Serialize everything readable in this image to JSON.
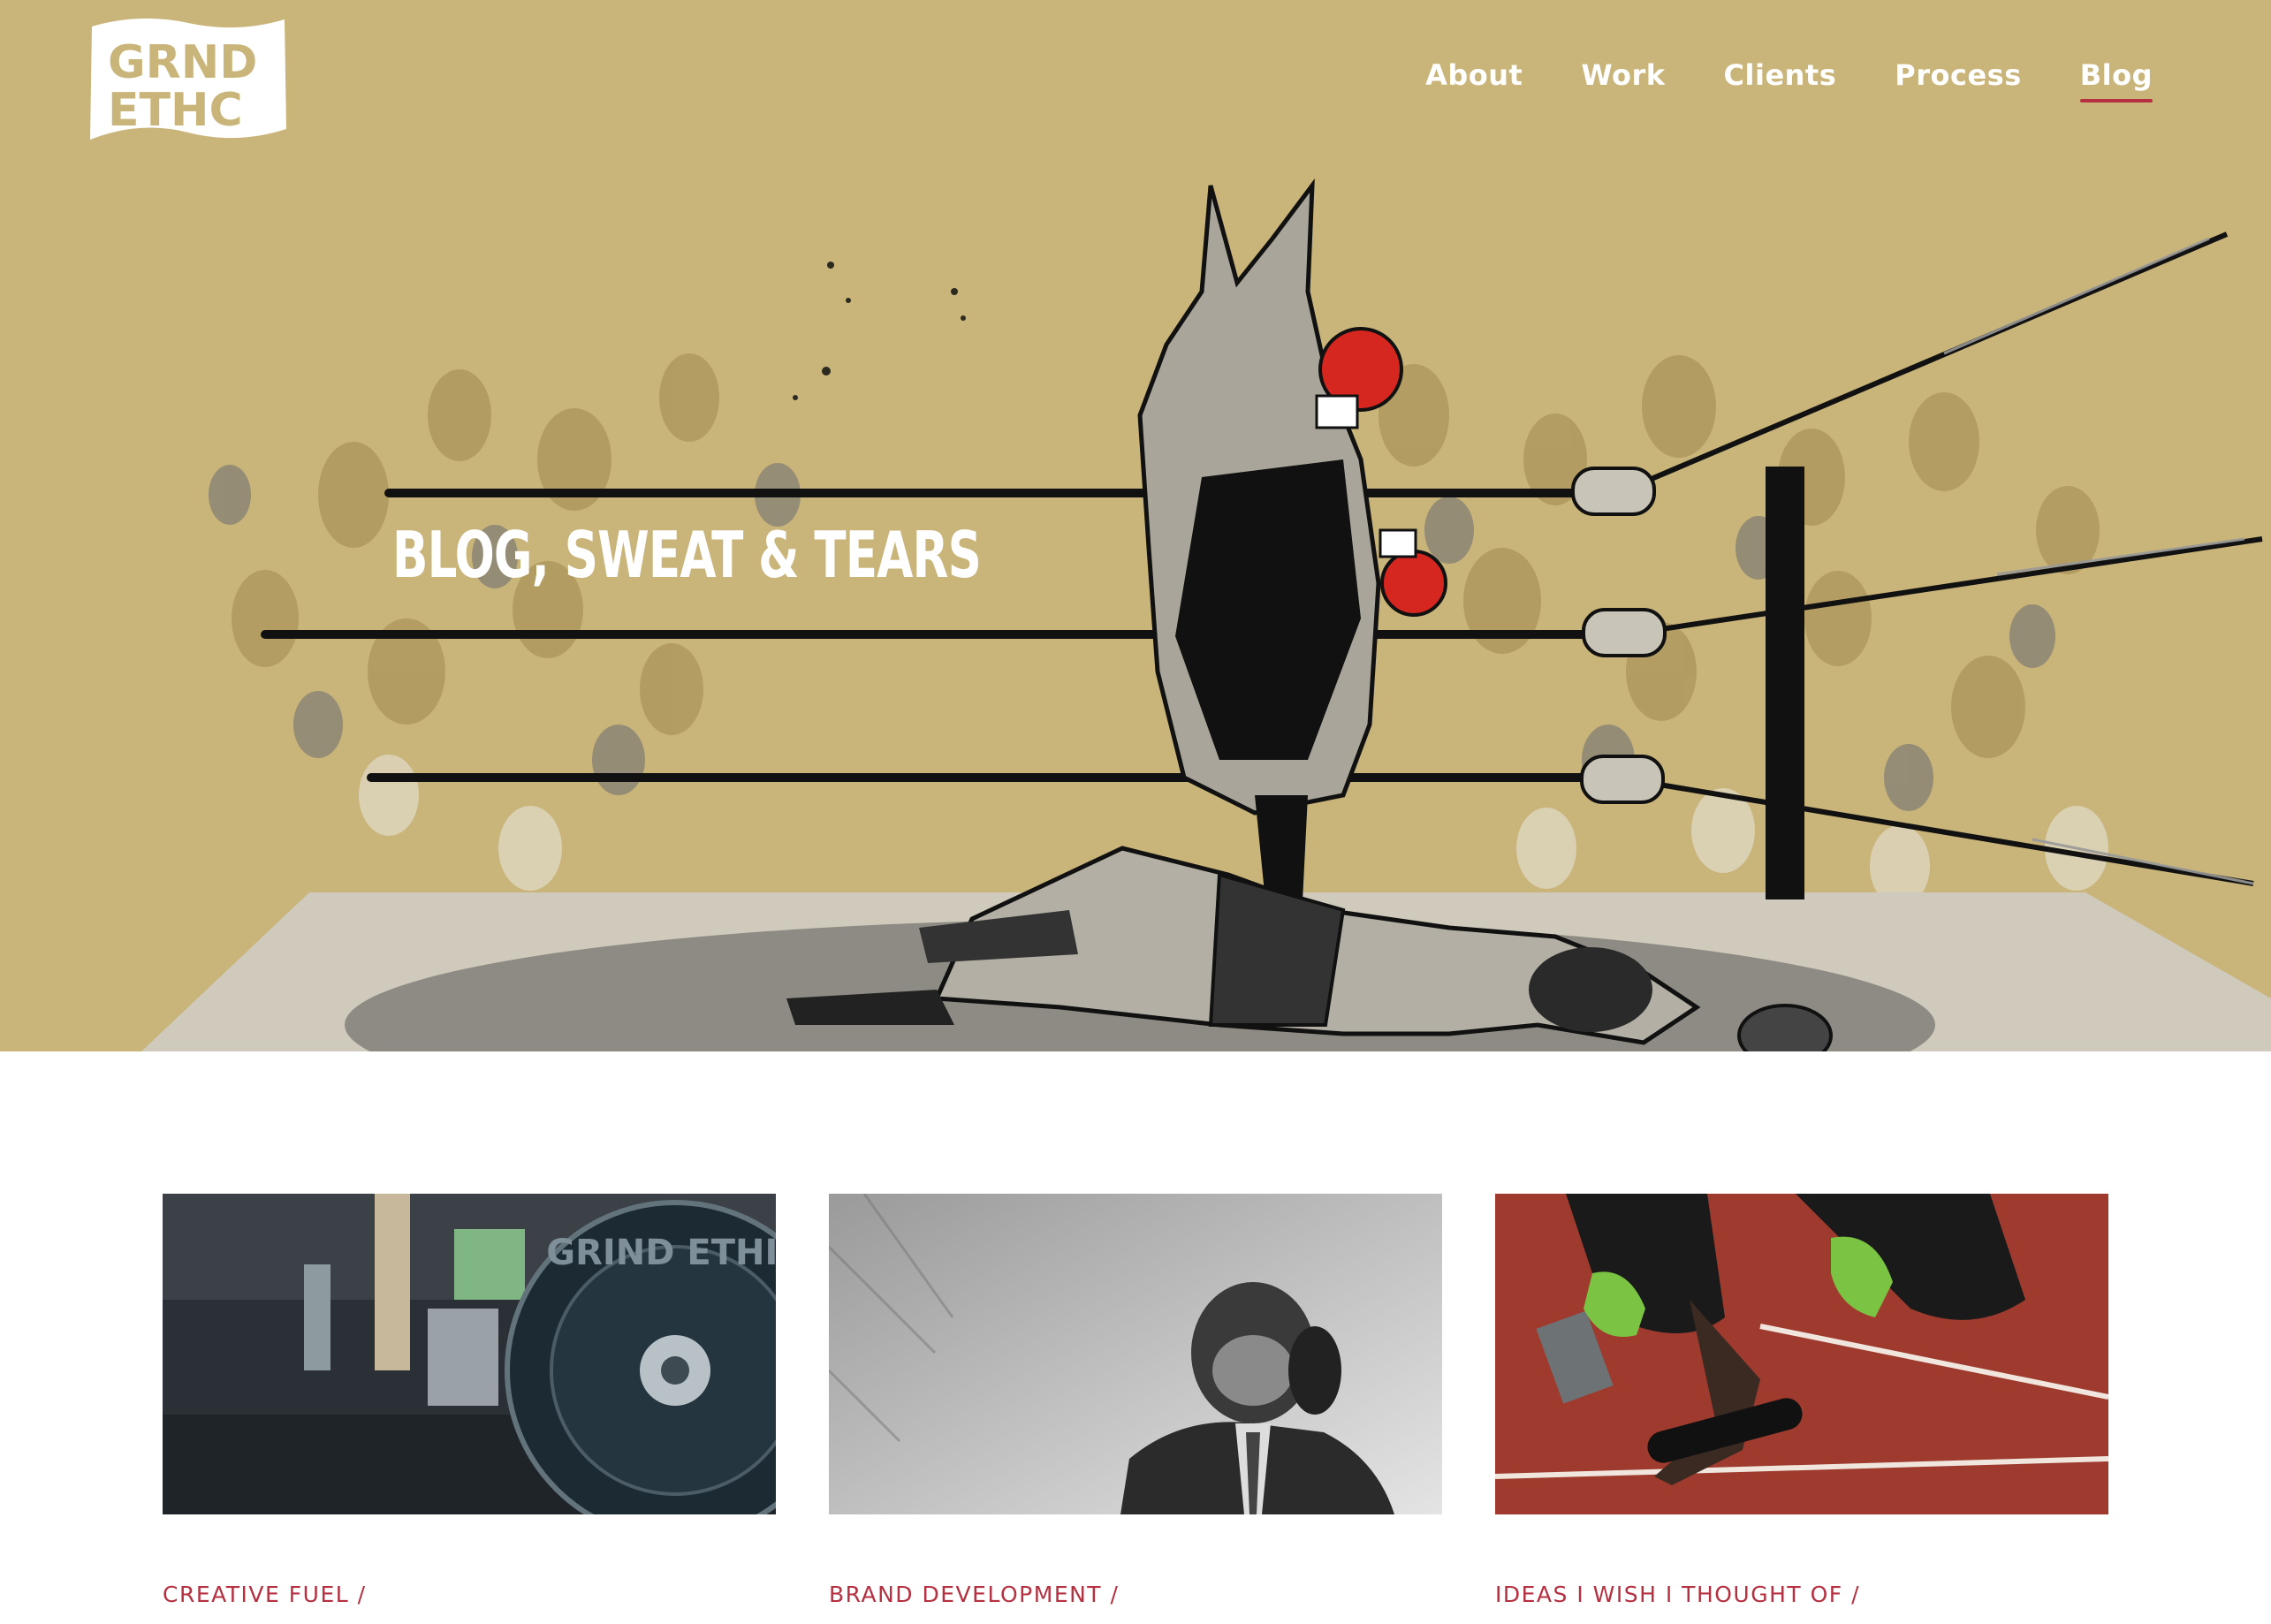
{
  "colors": {
    "hero_bg": "#c9b47a",
    "accent": "#b53141",
    "nav_text": "#ffffff",
    "page_bg": "#ffffff"
  },
  "logo": {
    "line1": "GRND",
    "line2": "ETHC"
  },
  "nav": {
    "items": [
      {
        "label": "About",
        "active": false
      },
      {
        "label": "Work",
        "active": false
      },
      {
        "label": "Clients",
        "active": false
      },
      {
        "label": "Process",
        "active": false
      },
      {
        "label": "Blog",
        "active": true
      }
    ]
  },
  "hero": {
    "title_strong": "BLOG",
    "title_rest": ", SWEAT & TEARS",
    "illustration": "kangaroo-boxer-knockout-illustration"
  },
  "cards": [
    {
      "category": "CREATIVE FUEL /",
      "image": "barbell-plate-photo",
      "plate_text": "GRIND ETHIC"
    },
    {
      "category": "BRAND DEVELOPMENT /",
      "image": "chimpanzee-in-suit-on-phone-photo"
    },
    {
      "category": "IDEAS I WISH I THOUGHT OF /",
      "image": "sprinter-relay-start-photo"
    }
  ]
}
